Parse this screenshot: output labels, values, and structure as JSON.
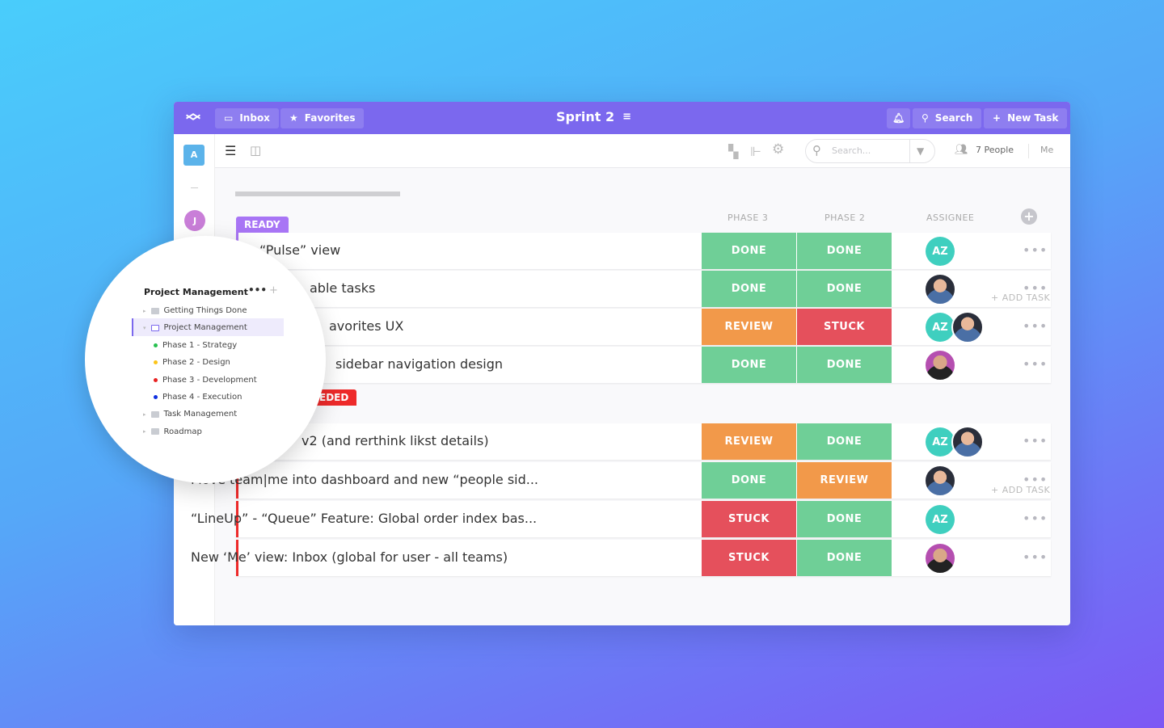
{
  "header": {
    "inbox": "Inbox",
    "favorites": "Favorites",
    "title": "Sprint 2",
    "search": "Search",
    "new_task": "New Task"
  },
  "rail": {
    "workspace_initial": "A",
    "user_initial": "J"
  },
  "toolbar": {
    "search_placeholder": "Search...",
    "people": "7 People",
    "me": "Me"
  },
  "columns": {
    "phase3": "PHASE 3",
    "phase2": "PHASE 2",
    "assignee": "ASSIGNEE"
  },
  "colors": {
    "accent": "#7b68ee",
    "done": "#6fcf97",
    "review": "#f2994a",
    "stuck": "#e5505c",
    "ready": "#a875f5",
    "group2": "#ee2a2a"
  },
  "groups": [
    {
      "label": "READY",
      "add_task": "+ ADD TASK",
      "tasks": [
        {
          "name": "“Pulse” view",
          "phase3": "DONE",
          "phase2": "DONE",
          "assignee": "AZ"
        },
        {
          "name": "able tasks",
          "phase3": "DONE",
          "phase2": "DONE",
          "assignee": "photo"
        },
        {
          "name": "avorites UX",
          "phase3": "REVIEW",
          "phase2": "STUCK",
          "assignee": "AZ+photo"
        },
        {
          "name": "sidebar navigation design",
          "phase3": "DONE",
          "phase2": "DONE",
          "assignee": "photo"
        }
      ]
    },
    {
      "label": "EDED",
      "add_task": "+ ADD TASK",
      "tasks": [
        {
          "name": "v2 (and rerthink likst details)",
          "phase3": "REVIEW",
          "phase2": "DONE",
          "assignee": "AZ+photo"
        },
        {
          "name": "Move team|me into dashboard and new “people sid...",
          "phase3": "DONE",
          "phase2": "REVIEW",
          "assignee": "photo"
        },
        {
          "name": "“LineUp” - “Queue” Feature: Global order index bas...",
          "phase3": "STUCK",
          "phase2": "DONE",
          "assignee": "AZ"
        },
        {
          "name": "New ‘Me’ view: Inbox (global for user - all teams)",
          "phase3": "STUCK",
          "phase2": "DONE",
          "assignee": "photo"
        }
      ]
    }
  ],
  "sidebar": {
    "title": "Project Management",
    "items": [
      {
        "label": "Getting Things Done"
      },
      {
        "label": "Project Management"
      },
      {
        "label": "Phase 1 - Strategy",
        "color": "#27c04f"
      },
      {
        "label": "Phase 2 - Design",
        "color": "#fcc419"
      },
      {
        "label": "Phase 3 - Development",
        "color": "#e82020"
      },
      {
        "label": "Phase 4 - Execution",
        "color": "#1030e0"
      },
      {
        "label": "Task Management"
      },
      {
        "label": "Roadmap"
      }
    ]
  }
}
